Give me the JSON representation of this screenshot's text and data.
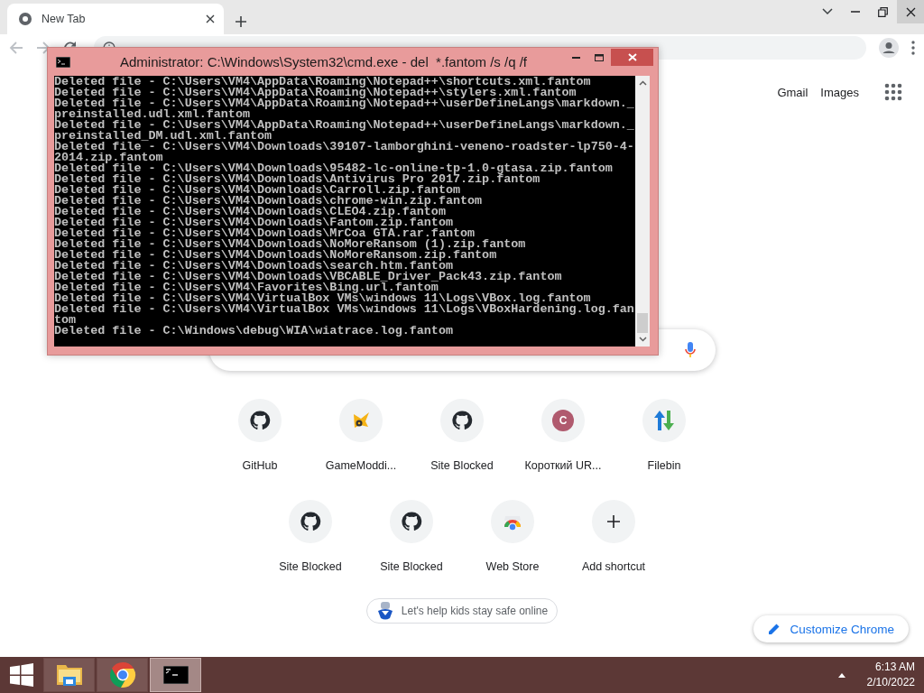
{
  "browser": {
    "tabs": [
      {
        "title": "New Tab",
        "selected": true
      }
    ],
    "header_links": [
      "Gmail",
      "Images"
    ],
    "shortcuts": [
      {
        "kind": "cat",
        "label": "GitHub"
      },
      {
        "kind": "mascot",
        "label": "GameModdi..."
      },
      {
        "kind": "cat",
        "label": "Site Blocked"
      },
      {
        "kind": "letter",
        "letter": "C",
        "color": "#b05a6e",
        "label": "Короткий UR..."
      },
      {
        "kind": "arrows",
        "label": "Filebin"
      },
      {
        "kind": "cat",
        "label": "Site Blocked"
      },
      {
        "kind": "cat",
        "label": "Site Blocked"
      },
      {
        "kind": "store",
        "label": "Web Store"
      },
      {
        "kind": "add",
        "label": "Add shortcut"
      }
    ],
    "promo": "Let's help kids stay safe online",
    "customize_button": "Customize Chrome"
  },
  "console_window": {
    "title": "Administrator: C:\\Windows\\System32\\cmd.exe - del  *.fantom /s /q /f",
    "lines": [
      "Deleted file - C:\\Users\\VM4\\AppData\\Roaming\\Notepad++\\shortcuts.xml.fantom",
      "Deleted file - C:\\Users\\VM4\\AppData\\Roaming\\Notepad++\\stylers.xml.fantom",
      "Deleted file - C:\\Users\\VM4\\AppData\\Roaming\\Notepad++\\userDefineLangs\\markdown._",
      "preinstalled.udl.xml.fantom",
      "Deleted file - C:\\Users\\VM4\\AppData\\Roaming\\Notepad++\\userDefineLangs\\markdown._",
      "preinstalled_DM.udl.xml.fantom",
      "Deleted file - C:\\Users\\VM4\\Downloads\\39107-lamborghini-veneno-roadster-lp750-4-",
      "2014.zip.fantom",
      "Deleted file - C:\\Users\\VM4\\Downloads\\95482-lc-online-tp-1.0-gtasa.zip.fantom",
      "Deleted file - C:\\Users\\VM4\\Downloads\\Antivirus Pro 2017.zip.fantom",
      "Deleted file - C:\\Users\\VM4\\Downloads\\Carroll.zip.fantom",
      "Deleted file - C:\\Users\\VM4\\Downloads\\chrome-win.zip.fantom",
      "Deleted file - C:\\Users\\VM4\\Downloads\\CLEO4.zip.fantom",
      "Deleted file - C:\\Users\\VM4\\Downloads\\Fantom.zip.fantom",
      "Deleted file - C:\\Users\\VM4\\Downloads\\MrCoa GTA.rar.fantom",
      "Deleted file - C:\\Users\\VM4\\Downloads\\NoMoreRansom (1).zip.fantom",
      "Deleted file - C:\\Users\\VM4\\Downloads\\NoMoreRansom.zip.fantom",
      "Deleted file - C:\\Users\\VM4\\Downloads\\search.htm.fantom",
      "Deleted file - C:\\Users\\VM4\\Downloads\\VBCABLE_Driver_Pack43.zip.fantom",
      "Deleted file - C:\\Users\\VM4\\Favorites\\Bing.url.fantom",
      "Deleted file - C:\\Users\\VM4\\VirtualBox VMs\\windows 11\\Logs\\VBox.log.fantom",
      "Deleted file - C:\\Users\\VM4\\VirtualBox VMs\\windows 11\\Logs\\VBoxHardening.log.fan",
      "tom",
      "Deleted file - C:\\Windows\\debug\\WIA\\wiatrace.log.fantom"
    ]
  },
  "taskbar": {
    "apps": [
      {
        "kind": "folder",
        "selected": false
      },
      {
        "kind": "browser",
        "selected": false
      },
      {
        "kind": "terminal",
        "selected": true
      }
    ],
    "time": "6:13 AM",
    "date": "2/10/2022"
  }
}
